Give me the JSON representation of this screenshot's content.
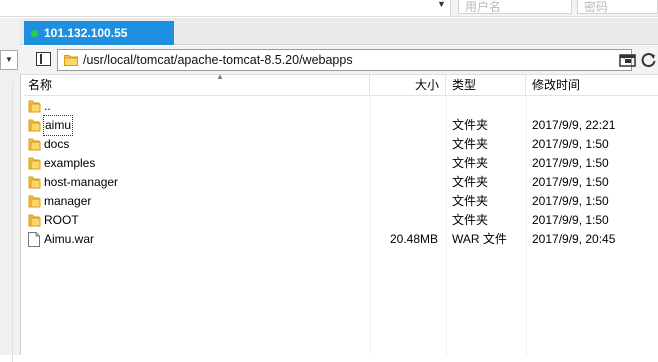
{
  "topbar": {
    "username_placeholder": "用户名",
    "password_placeholder": "密码"
  },
  "tab": {
    "title": "101.132.100.55",
    "status_color": "#27d23c",
    "accent": "#1e90df"
  },
  "path": {
    "value": "/usr/local/tomcat/apache-tomcat-8.5.20/webapps"
  },
  "columns": {
    "name": "名称",
    "size": "大小",
    "type": "类型",
    "modified": "修改时间"
  },
  "files": [
    {
      "name": "..",
      "size": "",
      "type": "",
      "modified": "",
      "icon": "folder-icon"
    },
    {
      "name": "aimu",
      "size": "",
      "type": "文件夹",
      "modified": "2017/9/9, 22:21",
      "icon": "folder-icon"
    },
    {
      "name": "docs",
      "size": "",
      "type": "文件夹",
      "modified": "2017/9/9, 1:50",
      "icon": "folder-icon"
    },
    {
      "name": "examples",
      "size": "",
      "type": "文件夹",
      "modified": "2017/9/9, 1:50",
      "icon": "folder-icon"
    },
    {
      "name": "host-manager",
      "size": "",
      "type": "文件夹",
      "modified": "2017/9/9, 1:50",
      "icon": "folder-icon"
    },
    {
      "name": "manager",
      "size": "",
      "type": "文件夹",
      "modified": "2017/9/9, 1:50",
      "icon": "folder-icon"
    },
    {
      "name": "ROOT",
      "size": "",
      "type": "文件夹",
      "modified": "2017/9/9, 1:50",
      "icon": "folder-icon"
    },
    {
      "name": "Aimu.war",
      "size": "20.48MB",
      "type": "WAR 文件",
      "modified": "2017/9/9, 20:45",
      "icon": "file-icon"
    }
  ]
}
